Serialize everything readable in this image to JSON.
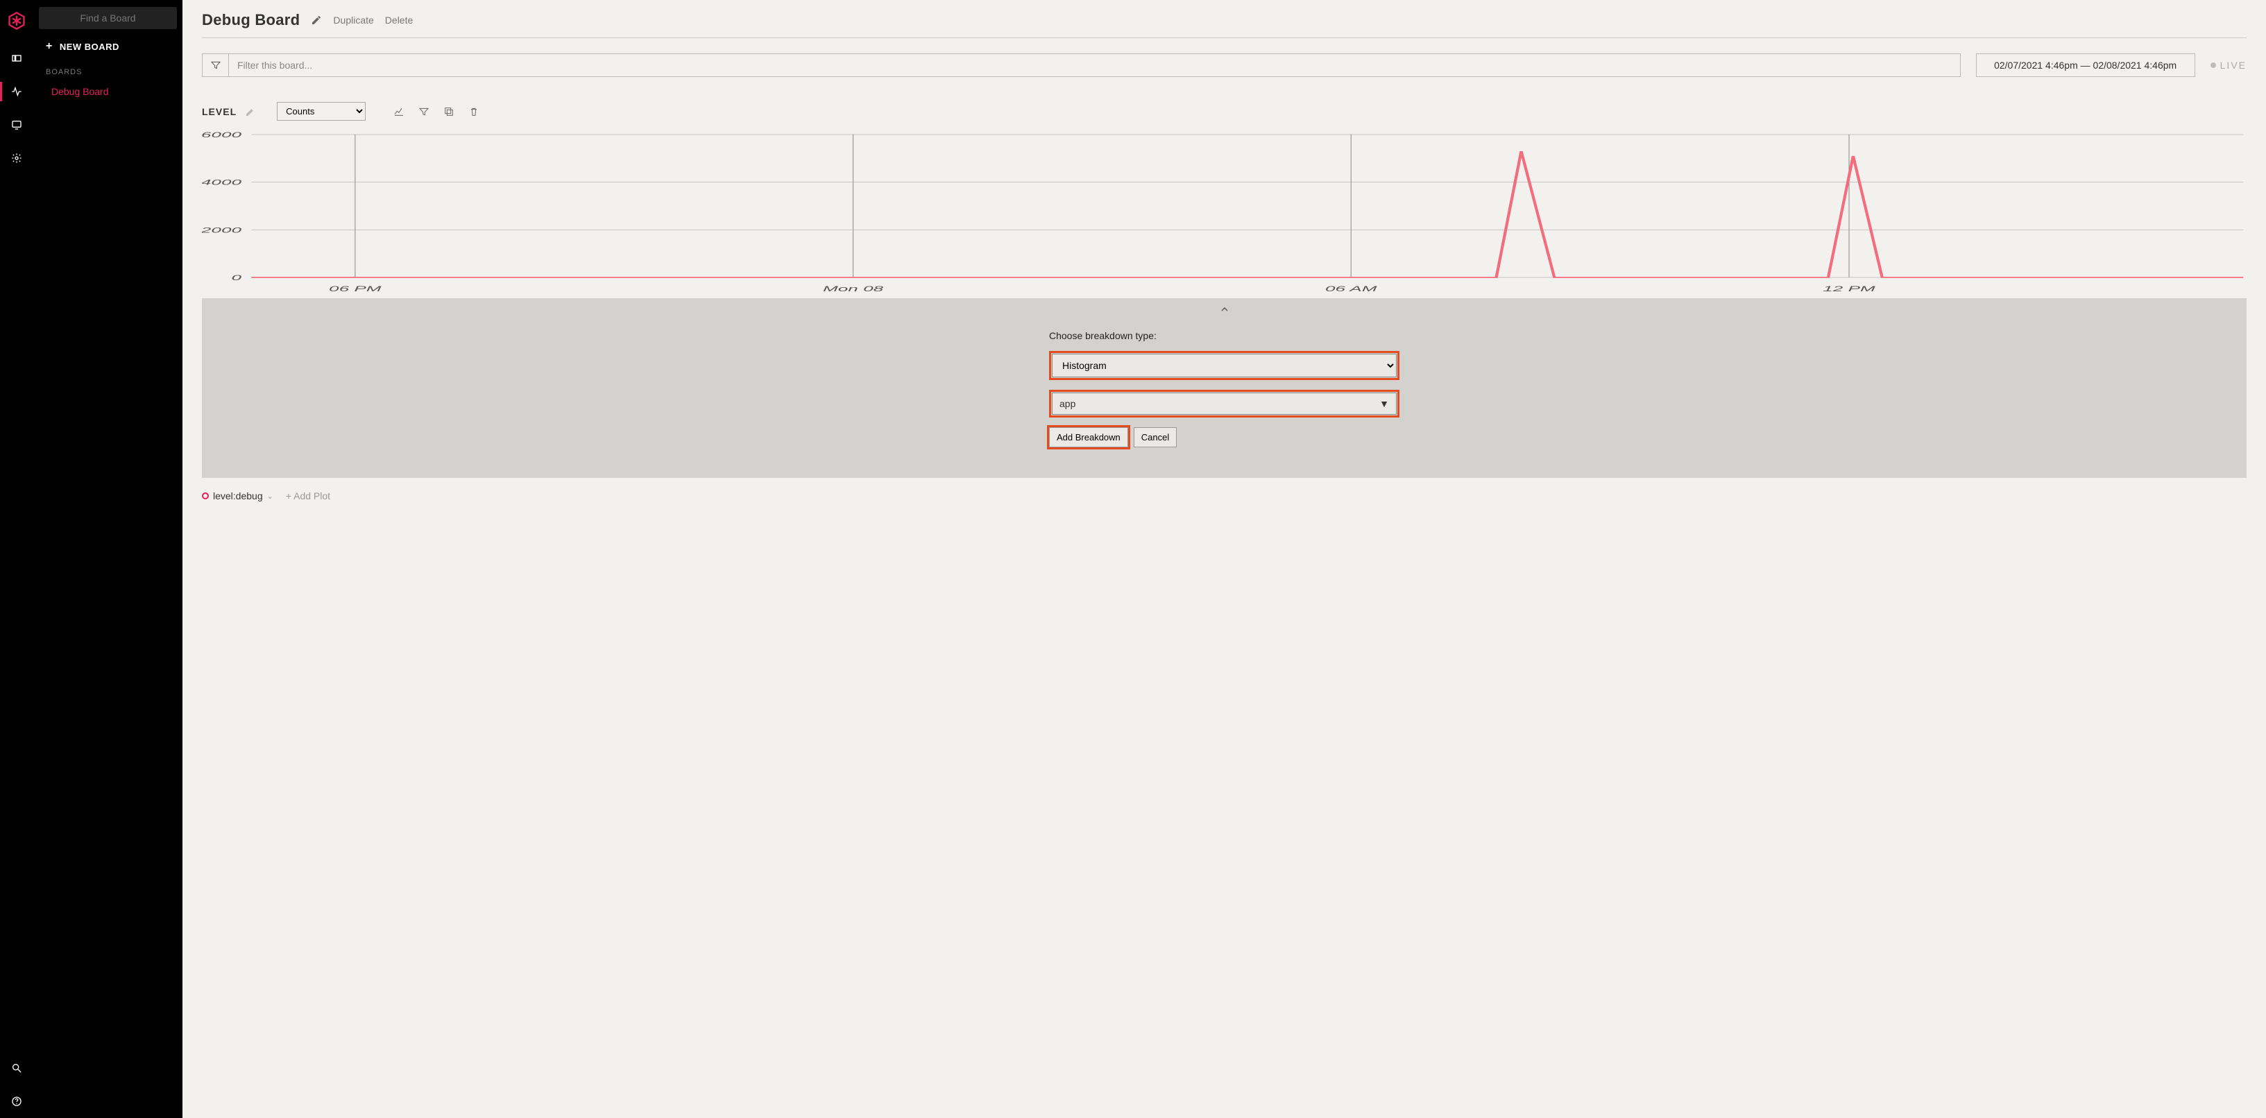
{
  "sidebar": {
    "find_placeholder": "Find a Board",
    "new_board_label": "NEW BOARD",
    "boards_heading": "BOARDS",
    "items": [
      {
        "label": "Debug Board"
      }
    ]
  },
  "header": {
    "title": "Debug Board",
    "duplicate": "Duplicate",
    "delete": "Delete"
  },
  "filter": {
    "placeholder": "Filter this board...",
    "date_range": "02/07/2021 4:46pm — 02/08/2021 4:46pm",
    "live_label": "LIVE"
  },
  "plot": {
    "title": "LEVEL",
    "mode": "Counts"
  },
  "breakdown": {
    "label": "Choose breakdown type:",
    "type": "Histogram",
    "field": "app",
    "add_label": "Add Breakdown",
    "cancel_label": "Cancel"
  },
  "legend": {
    "item0": "level:debug",
    "add_plot": "+ Add Plot"
  },
  "chart_data": {
    "type": "line",
    "xlabel": "",
    "ylabel": "",
    "ylim": [
      0,
      6000
    ],
    "y_ticks": [
      0,
      2000,
      4000,
      6000
    ],
    "x_ticks": [
      "06 PM",
      "Mon 08",
      "06 AM",
      "12 PM"
    ],
    "x_tick_positions_hours": [
      1.25,
      7.25,
      13.25,
      19.25
    ],
    "x_range_hours": 24,
    "series": [
      {
        "name": "level:debug",
        "color": "#f26d7d",
        "points": [
          {
            "t_hours": 0.0,
            "value": 0
          },
          {
            "t_hours": 15.0,
            "value": 0
          },
          {
            "t_hours": 15.3,
            "value": 5300
          },
          {
            "t_hours": 15.7,
            "value": 0
          },
          {
            "t_hours": 19.0,
            "value": 0
          },
          {
            "t_hours": 19.3,
            "value": 5100
          },
          {
            "t_hours": 19.65,
            "value": 0
          },
          {
            "t_hours": 24.0,
            "value": 0
          }
        ]
      }
    ]
  }
}
